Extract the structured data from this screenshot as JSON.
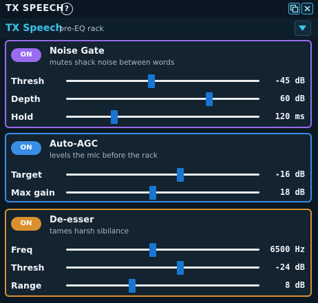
{
  "window": {
    "title": "TX SPEECH",
    "help_glyph": "?"
  },
  "header": {
    "title": "TX Speech",
    "subtitle": "pre-EQ rack"
  },
  "colors": {
    "accent": "#3cc4ea",
    "noise_gate": "#9a6cf0",
    "auto_agc": "#3a8ee6",
    "de_esser": "#d9902e",
    "thumb": "#1876d2"
  },
  "panels": [
    {
      "id": "noise-gate",
      "toggle": "ON",
      "name": "Noise Gate",
      "desc": "mutes shack noise between words",
      "rows": [
        {
          "label": "Thresh",
          "value": "-45 dB",
          "level": 0.44
        },
        {
          "label": "Depth",
          "value": "60 dB",
          "level": 0.74
        },
        {
          "label": "Hold",
          "value": "120 ms",
          "level": 0.25
        }
      ]
    },
    {
      "id": "auto-agc",
      "toggle": "ON",
      "name": "Auto-AGC",
      "desc": "levels the mic before the rack",
      "rows": [
        {
          "label": "Target",
          "value": "-16 dB",
          "level": 0.59
        },
        {
          "label": "Max gain",
          "value": "18 dB",
          "level": 0.45
        }
      ]
    },
    {
      "id": "de-esser",
      "toggle": "ON",
      "name": "De-esser",
      "desc": "tames harsh sibilance",
      "rows": [
        {
          "label": "Freq",
          "value": "6500 Hz",
          "level": 0.45
        },
        {
          "label": "Thresh",
          "value": "-24 dB",
          "level": 0.59
        },
        {
          "label": "Range",
          "value": "8 dB",
          "level": 0.34
        }
      ]
    }
  ]
}
